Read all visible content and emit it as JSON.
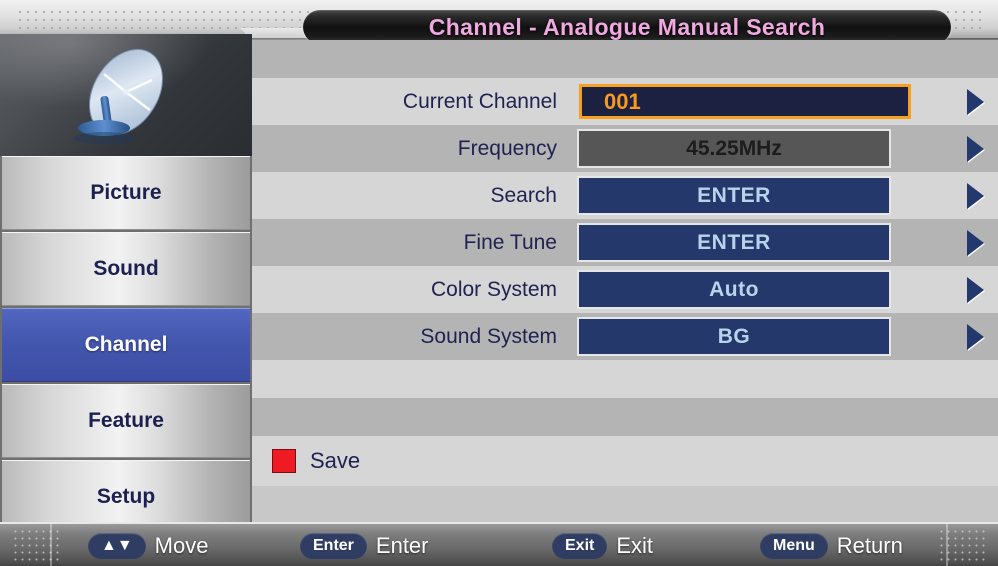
{
  "header": {
    "title": "Channel - Analogue Manual Search"
  },
  "sidebar": {
    "icon": "satellite-dish-icon",
    "items": [
      {
        "label": "Picture",
        "selected": false
      },
      {
        "label": "Sound",
        "selected": false
      },
      {
        "label": "Channel",
        "selected": true
      },
      {
        "label": "Feature",
        "selected": false
      },
      {
        "label": "Setup",
        "selected": false
      }
    ]
  },
  "settings": {
    "rows": [
      {
        "label": "Current Channel",
        "value": "001",
        "state": "focus"
      },
      {
        "label": "Frequency",
        "value": "45.25MHz",
        "state": "disabled"
      },
      {
        "label": "Search",
        "value": "ENTER",
        "state": "normal"
      },
      {
        "label": "Fine Tune",
        "value": "ENTER",
        "state": "normal"
      },
      {
        "label": "Color System",
        "value": "Auto",
        "state": "normal"
      },
      {
        "label": "Sound System",
        "value": "BG",
        "state": "normal"
      }
    ],
    "save": {
      "label": "Save",
      "marker": "red-square-icon",
      "marker_color": "#ee1b24"
    }
  },
  "footer": {
    "items": [
      {
        "key": "▲▼",
        "action": "Move",
        "key_name": "up-down-arrows-icon"
      },
      {
        "key": "Enter",
        "action": "Enter",
        "key_name": "enter-key"
      },
      {
        "key": "Exit",
        "action": "Exit",
        "key_name": "exit-key"
      },
      {
        "key": "Menu",
        "action": "Return",
        "key_name": "menu-key"
      }
    ]
  },
  "colors": {
    "title_text": "#f0a8e0",
    "focus_border": "#f5a020",
    "focus_value": "#f79a1e",
    "value_box": "#24386b",
    "value_text": "#b8d4ea",
    "label_text": "#1e2250",
    "active_menu": "#4356ae"
  }
}
